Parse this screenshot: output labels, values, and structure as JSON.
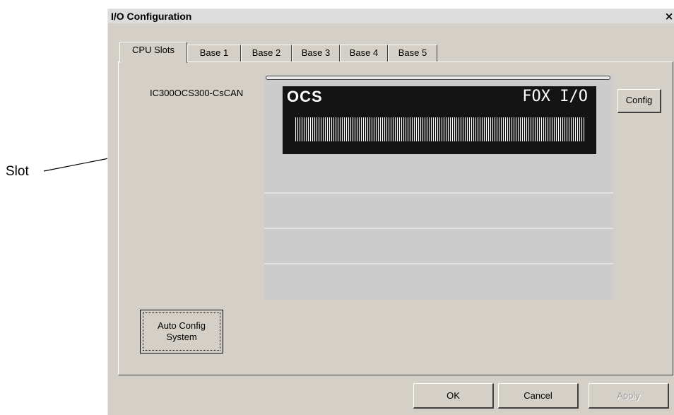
{
  "callout": {
    "label": "Slot"
  },
  "window": {
    "title": "I/O Configuration",
    "close_label": "×"
  },
  "tabs": [
    {
      "label": "CPU Slots",
      "active": true
    },
    {
      "label": "Base 1"
    },
    {
      "label": "Base 2"
    },
    {
      "label": "Base 3"
    },
    {
      "label": "Base 4"
    },
    {
      "label": "Base 5"
    }
  ],
  "slot": {
    "module_name": "IC300OCS300-CsCAN",
    "module_brand_left": "OCS",
    "module_brand_right": "FOX I/O",
    "config_label": "Config"
  },
  "auto_config": {
    "line1": "Auto Config",
    "line2": "System"
  },
  "footer": {
    "ok_label": "OK",
    "cancel_label": "Cancel",
    "apply_label": "Apply"
  },
  "colors": {
    "dialog_face": "#d4d0c8",
    "slot_area": "#cccccc",
    "module_body": "#141414"
  }
}
